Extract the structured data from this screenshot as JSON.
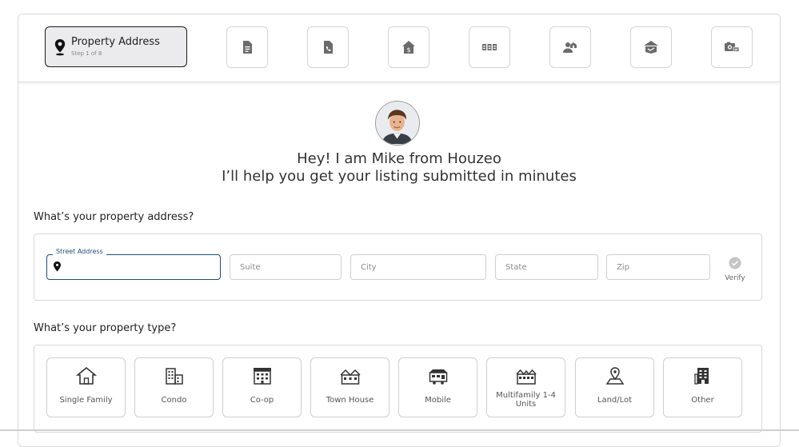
{
  "stepper": {
    "active_title": "Property Address",
    "active_sub": "Step 1 of 8",
    "steps": [
      {
        "icon": "document-icon"
      },
      {
        "icon": "phone-icon"
      },
      {
        "icon": "house-dollar-icon"
      },
      {
        "icon": "rooms-icon"
      },
      {
        "icon": "agent-icon"
      },
      {
        "icon": "handshake-house-icon"
      },
      {
        "icon": "camera-icon"
      }
    ]
  },
  "intro": {
    "line1": "Hey! I am Mike from Houzeo",
    "line2": "I’ll help you get your listing submitted in minutes"
  },
  "address": {
    "question": "What’s your property address?",
    "street_label": "Street Address",
    "street_value": "",
    "suite_placeholder": "Suite",
    "city_placeholder": "City",
    "state_placeholder": "State",
    "zip_placeholder": "Zip",
    "verify_label": "Verify"
  },
  "property_type": {
    "question": "What’s your property type?",
    "options": [
      {
        "label": "Single Family"
      },
      {
        "label": "Condo"
      },
      {
        "label": "Co-op"
      },
      {
        "label": "Town House"
      },
      {
        "label": "Mobile"
      },
      {
        "label": "Multifamily 1-4 Units"
      },
      {
        "label": "Land/Lot"
      },
      {
        "label": "Other"
      }
    ]
  },
  "colors": {
    "accent": "#1d4f7a",
    "active_step_bg": "#ebebee",
    "border": "#d9d9d9"
  }
}
